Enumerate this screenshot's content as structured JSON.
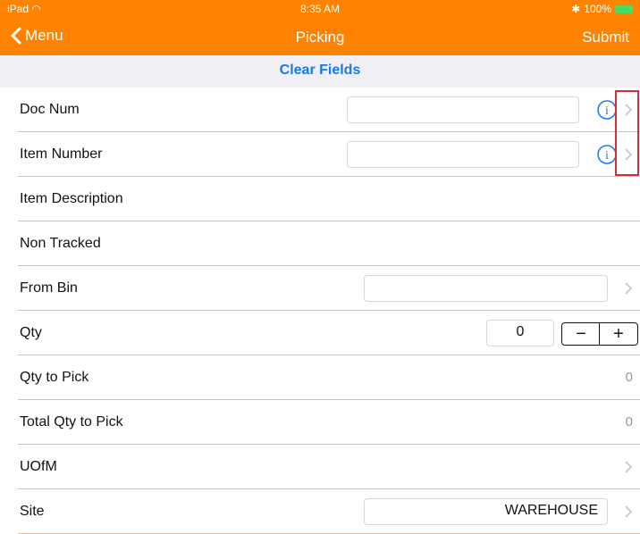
{
  "status": {
    "carrier": "iPad",
    "time": "8:35 AM",
    "battery": "100%"
  },
  "nav": {
    "back_label": "Menu",
    "title": "Picking",
    "submit_label": "Submit"
  },
  "clear_label": "Clear Fields",
  "rows": {
    "doc_num": {
      "label": "Doc Num",
      "value": ""
    },
    "item_number": {
      "label": "Item Number",
      "value": ""
    },
    "item_description": {
      "label": "Item Description"
    },
    "non_tracked": {
      "label": "Non Tracked"
    },
    "from_bin": {
      "label": "From Bin",
      "value": ""
    },
    "qty": {
      "label": "Qty",
      "value": "0",
      "minus": "−",
      "plus": "+"
    },
    "qty_to_pick": {
      "label": "Qty to Pick",
      "value": "0"
    },
    "total_qty_to_pick": {
      "label": "Total Qty to Pick",
      "value": "0"
    },
    "uofm": {
      "label": "UOfM"
    },
    "site": {
      "label": "Site",
      "value": "WAREHOUSE"
    }
  },
  "colors": {
    "accent": "#ff8300",
    "link": "#1779f0",
    "highlight": "#d0303a"
  },
  "icons": [
    "wifi-icon",
    "bluetooth-icon",
    "battery-icon",
    "back-chevron-icon",
    "info-icon",
    "chevron-right-icon"
  ]
}
